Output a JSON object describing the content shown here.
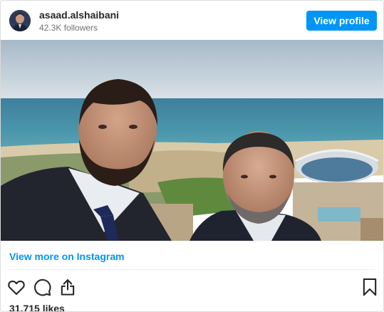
{
  "post": {
    "username": "asaad.alshaibani",
    "followers": "42.3K followers",
    "view_profile_label": "View profile",
    "view_more_label": "View more on Instagram",
    "likes": "31,715 likes"
  },
  "icons": {
    "like": "heart-icon",
    "comment": "comment-icon",
    "share": "share-icon",
    "save": "bookmark-icon"
  },
  "colors": {
    "accent": "#0095f6",
    "text": "#262626",
    "muted": "#737373",
    "border": "#dbdbdb"
  }
}
